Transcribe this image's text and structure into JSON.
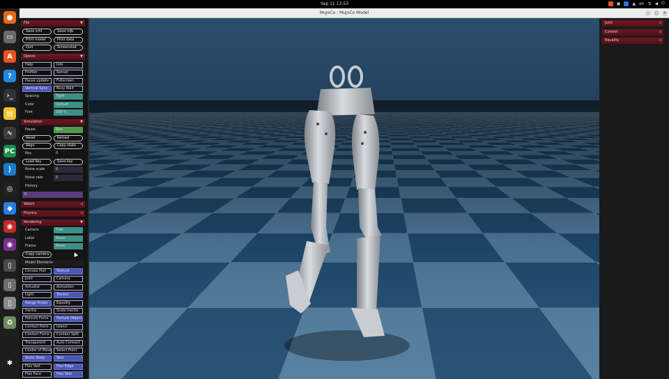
{
  "topbar": {
    "clock": "Sep 11  13:53",
    "lang": "en"
  },
  "window": {
    "title": "MuJoCo : MuJoCo Model"
  },
  "dock": {
    "items": [
      {
        "name": "firefox-icon",
        "glyph": "●",
        "color": "#e8681a"
      },
      {
        "name": "files-icon",
        "glyph": "▭",
        "color": "#6a6a6a"
      },
      {
        "name": "app-center-icon",
        "glyph": "A",
        "color": "#e95420"
      },
      {
        "name": "help-icon",
        "glyph": "?",
        "color": "#1e88e5"
      },
      {
        "name": "terminal-icon",
        "glyph": "›_",
        "color": "#333"
      },
      {
        "name": "notes-icon",
        "glyph": "▤",
        "color": "#f2c230"
      },
      {
        "name": "system-monitor-icon",
        "glyph": "∿",
        "color": "#3c3c3c"
      },
      {
        "name": "pycharm-icon",
        "glyph": "PC",
        "color": "#1b8f4c"
      },
      {
        "name": "vscode-icon",
        "glyph": "⟩",
        "color": "#1d7acc"
      },
      {
        "name": "obs-icon",
        "glyph": "◎",
        "color": "#222"
      },
      {
        "name": "todesk-icon",
        "glyph": "◆",
        "color": "#2a7de1"
      },
      {
        "name": "chat-icon",
        "glyph": "◉",
        "color": "#c62828"
      },
      {
        "name": "disc-icon",
        "glyph": "◉",
        "color": "#7b2b8f"
      },
      {
        "name": "drive-icon-1",
        "glyph": "▯",
        "color": "#4a4a4a"
      },
      {
        "name": "drive-icon-2",
        "glyph": "▯",
        "color": "#6d6d6d"
      },
      {
        "name": "drive-icon-3",
        "glyph": "▯",
        "color": "#8a8a8a"
      },
      {
        "name": "trash-icon",
        "glyph": "♻",
        "color": "#6f8f5f"
      },
      {
        "name": "show-apps-icon",
        "glyph": "✱",
        "color": "#1d1d1d"
      }
    ]
  },
  "left": {
    "file": {
      "title": "File",
      "buttons": [
        "Save xml",
        "Save mjb",
        "Print model",
        "Print data",
        "Quit",
        "Screenshot"
      ]
    },
    "option": {
      "title": "Option",
      "toggles": [
        "Help",
        "Info",
        "Profiler",
        "Sensor",
        "Pause update",
        "Fullscreen",
        "Vertical Sync",
        "Busy Wait"
      ],
      "spacing_label": "Spacing",
      "spacing_value": "Tight",
      "color_label": "Color",
      "color_value": "Default",
      "font_label": "Font",
      "font_value": "100 %"
    },
    "simulation": {
      "title": "Simulation",
      "pause_label": "Pause",
      "pause_value": "Run",
      "reset": "Reset",
      "reload": "Reload",
      "align": "Align",
      "copy_state": "Copy state",
      "key_label": "Key",
      "key_value": "0",
      "load_key": "Load key",
      "save_key": "Save key",
      "noise_scale_label": "Noise scale",
      "noise_scale_value": "0",
      "noise_rate_label": "Noise rate",
      "noise_rate_value": "0",
      "history_label": "History",
      "history_value": "0"
    },
    "watch": {
      "title": "Watch"
    },
    "physics": {
      "title": "Physics"
    },
    "rendering": {
      "title": "Rendering",
      "camera_label": "Camera",
      "camera_value": "Free",
      "label_label": "Label",
      "label_value": "None",
      "frame_label": "Frame",
      "frame_value": "None",
      "copy_camera": "Copy camera",
      "model_elements_label": "Model Elements",
      "elements": [
        {
          "label": "Convex Hull",
          "on": false
        },
        {
          "label": "Texture",
          "on": true
        },
        {
          "label": "Joint",
          "on": false
        },
        {
          "label": "Camera",
          "on": false
        },
        {
          "label": "Actuator",
          "on": false
        },
        {
          "label": "Activation",
          "on": false
        },
        {
          "label": "Light",
          "on": false
        },
        {
          "label": "Tendon",
          "on": true
        },
        {
          "label": "Range Finder",
          "on": true
        },
        {
          "label": "Equality",
          "on": false
        },
        {
          "label": "Inertia",
          "on": false
        },
        {
          "label": "Scale Inertia",
          "on": false
        },
        {
          "label": "Perturb Force",
          "on": false
        },
        {
          "label": "Perturb Object",
          "on": true
        },
        {
          "label": "Contact Point",
          "on": false
        },
        {
          "label": "Island",
          "on": false
        },
        {
          "label": "Contact Force",
          "on": false
        },
        {
          "label": "Contact Split",
          "on": false
        },
        {
          "label": "Transparent",
          "on": false
        },
        {
          "label": "Auto Connect",
          "on": false
        },
        {
          "label": "Center of Mass",
          "on": false
        },
        {
          "label": "Select Point",
          "on": false
        },
        {
          "label": "Static Body",
          "on": true
        },
        {
          "label": "Skin",
          "on": true
        },
        {
          "label": "Flex Vert",
          "on": false
        },
        {
          "label": "Flex Edge",
          "on": true
        },
        {
          "label": "Flex Face",
          "on": false
        },
        {
          "label": "Flex Skin",
          "on": true
        }
      ]
    }
  },
  "right": {
    "sections": [
      "Joint",
      "Control",
      "Equality"
    ]
  }
}
